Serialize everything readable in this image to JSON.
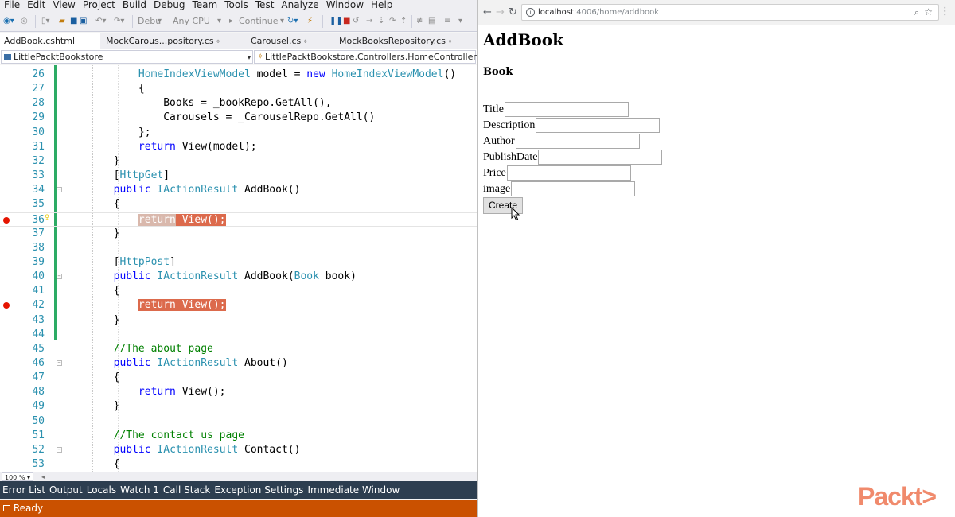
{
  "vs": {
    "menu": [
      "File",
      "Edit",
      "View",
      "Project",
      "Build",
      "Debug",
      "Team",
      "Tools",
      "Test",
      "Analyze",
      "Window",
      "Help"
    ],
    "toolbar": {
      "config": "Debu",
      "platform": "Any CPU",
      "continue": "Continue"
    },
    "tabs": [
      {
        "label": "AddBook.cshtml",
        "pin": ""
      },
      {
        "label": "MockCarous...pository.cs",
        "pin": "⌖"
      },
      {
        "label": "Carousel.cs",
        "pin": "⌖"
      },
      {
        "label": "MockBooksRepository.cs",
        "pin": "⌖"
      }
    ],
    "nav": {
      "project": "LittlePacktBookstore",
      "class": "LittlePacktBookstore.Controllers.HomeController"
    },
    "code_lines": [
      {
        "n": "26",
        "text": "            HomeIndexViewModel model = new HomeIndexViewModel()"
      },
      {
        "n": "27",
        "text": "            {"
      },
      {
        "n": "28",
        "text": "                Books = _bookRepo.GetAll(),"
      },
      {
        "n": "29",
        "text": "                Carousels = _CarouselRepo.GetAll()"
      },
      {
        "n": "30",
        "text": "            };"
      },
      {
        "n": "31",
        "text": "            return View(model);"
      },
      {
        "n": "32",
        "text": "        }"
      },
      {
        "n": "33",
        "text": "        [HttpGet]"
      },
      {
        "n": "34",
        "text": "        public IActionResult AddBook()"
      },
      {
        "n": "35",
        "text": "        {"
      },
      {
        "n": "36",
        "text": "            return View();"
      },
      {
        "n": "37",
        "text": "        }"
      },
      {
        "n": "38",
        "text": ""
      },
      {
        "n": "39",
        "text": "        [HttpPost]"
      },
      {
        "n": "40",
        "text": "        public IActionResult AddBook(Book book)"
      },
      {
        "n": "41",
        "text": "        {"
      },
      {
        "n": "42",
        "text": "            return View();"
      },
      {
        "n": "43",
        "text": "        }"
      },
      {
        "n": "44",
        "text": ""
      },
      {
        "n": "45",
        "text": "        //The about page"
      },
      {
        "n": "46",
        "text": "        public IActionResult About()"
      },
      {
        "n": "47",
        "text": "        {"
      },
      {
        "n": "48",
        "text": "            return View();"
      },
      {
        "n": "49",
        "text": "        }"
      },
      {
        "n": "50",
        "text": ""
      },
      {
        "n": "51",
        "text": "        //The contact us page"
      },
      {
        "n": "52",
        "text": "        public IActionResult Contact()"
      },
      {
        "n": "53",
        "text": "        {"
      }
    ],
    "zoom": "100 %",
    "bottom_tabs": [
      "Error List",
      "Output",
      "Locals",
      "Watch 1",
      "Call Stack",
      "Exception Settings",
      "Immediate Window"
    ],
    "status": "Ready"
  },
  "browser": {
    "url_host": "localhost",
    "url_path": ":4006/home/addbook",
    "page": {
      "title": "AddBook",
      "subtitle": "Book",
      "fields": [
        "Title",
        "Description",
        "Author",
        "PublishDate",
        "Price",
        "image"
      ],
      "submit": "Create"
    }
  },
  "watermark": "Packt>"
}
